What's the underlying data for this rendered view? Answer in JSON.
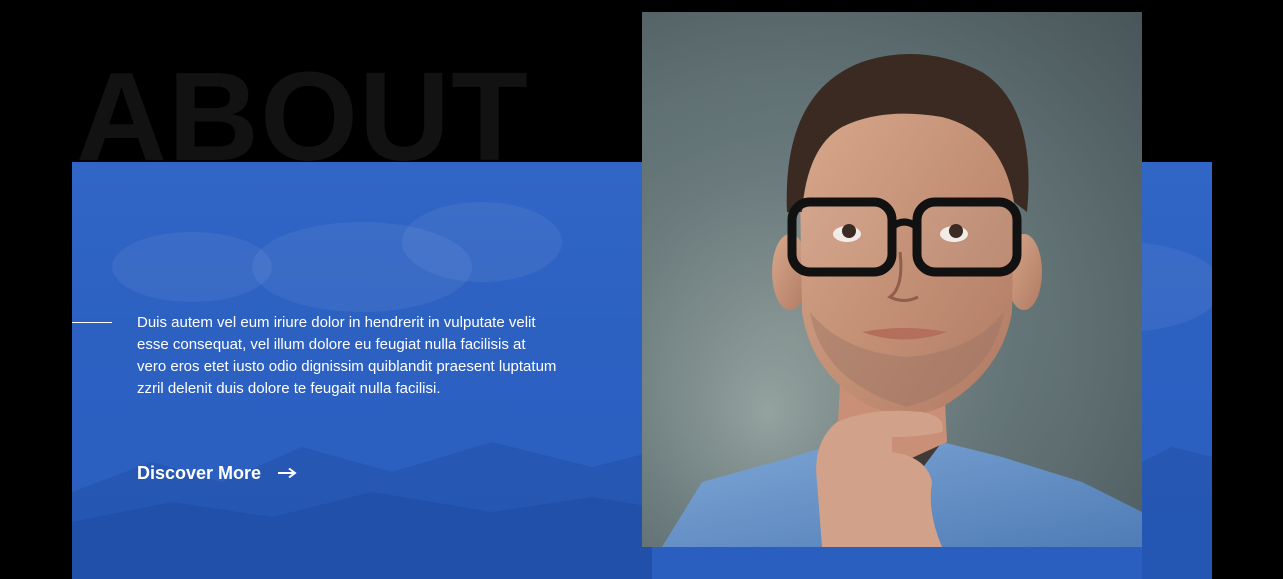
{
  "section": {
    "background_title": "ABOUT",
    "paragraph": "Duis autem vel eum iriure dolor in hendrerit in vulputate velit esse consequat, vel illum dolore eu feugiat nulla facilisis at vero eros etet iusto odio dignissim quiblandit praesent luptatum zzril delenit duis dolore te feugait nulla facilisi.",
    "cta_label": "Discover More",
    "cta_icon": "arrow-right-icon",
    "portrait_alt": "man-with-glasses-thinking"
  },
  "colors": {
    "page_background": "#000000",
    "panel_blue": "#2c61c2",
    "text": "#ffffff",
    "title_ghost": "#121212"
  }
}
